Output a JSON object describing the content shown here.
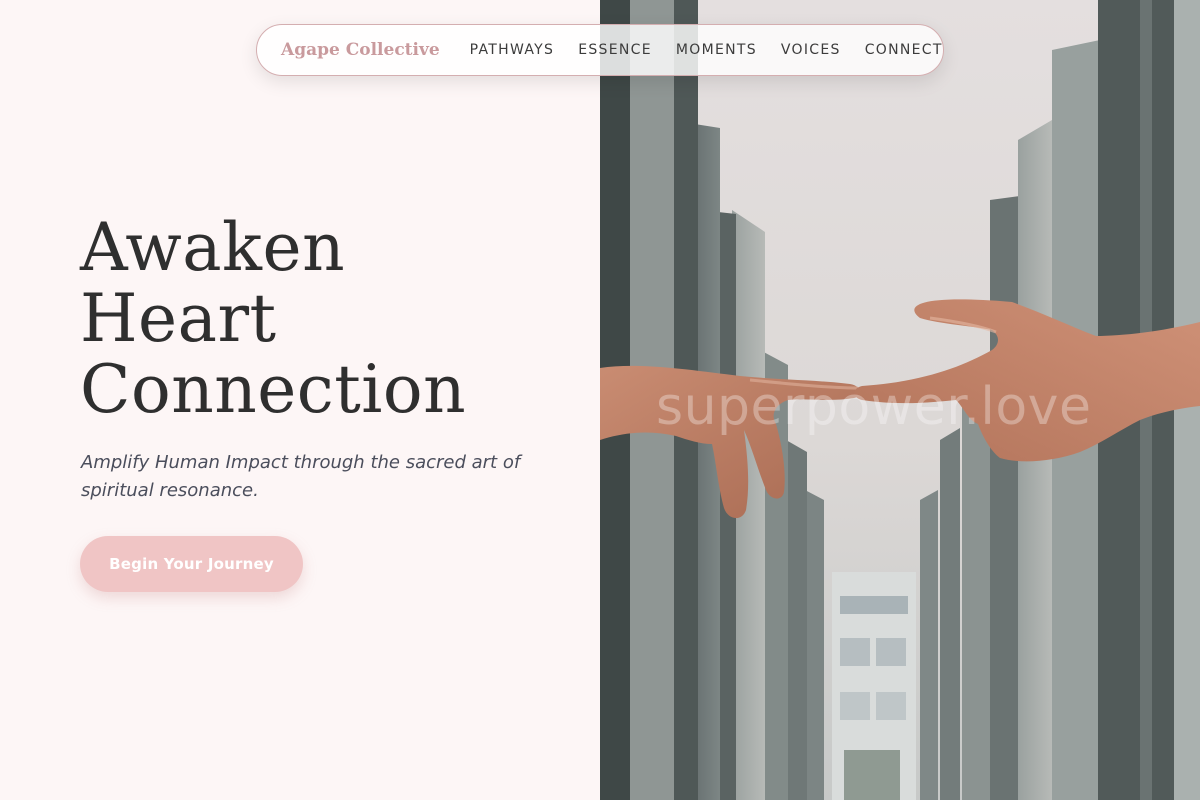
{
  "nav": {
    "brand": "Agape Collective",
    "links": [
      {
        "label": "PATHWAYS"
      },
      {
        "label": "ESSENCE"
      },
      {
        "label": "MOMENTS"
      },
      {
        "label": "VOICES"
      },
      {
        "label": "CONNECT"
      }
    ]
  },
  "hero": {
    "title_lines": [
      "Awaken",
      "Heart",
      "Connection"
    ],
    "subtitle": "Amplify Human Impact through the sacred art of spiritual resonance.",
    "cta_label": "Begin Your Journey"
  },
  "photo": {
    "watermark": "superpower.love",
    "alt": "Two hands reaching toward each other between tall concrete pillars"
  },
  "colors": {
    "background": "#fdf6f6",
    "brand": "#c99a9d",
    "cta": "#f0c5c5",
    "title": "#2f2f2f",
    "subtitle": "#4b4e5c",
    "nav_border": "#d4aeb0"
  }
}
